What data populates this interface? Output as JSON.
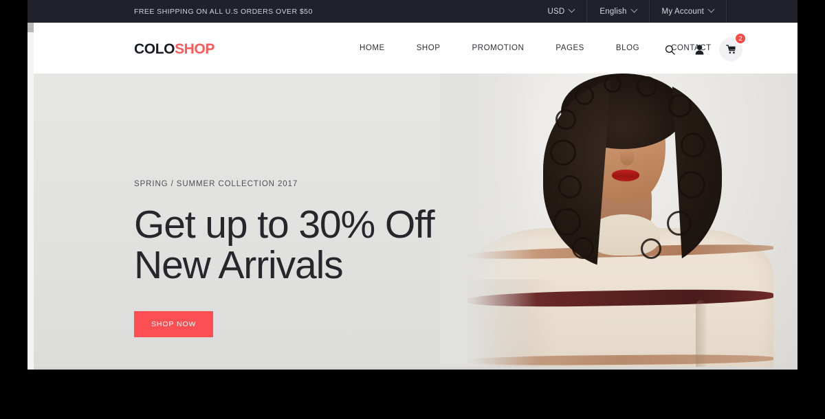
{
  "topbar": {
    "announcement": "FREE SHIPPING ON ALL U.S ORDERS OVER $50",
    "dropdowns": [
      {
        "label": "USD",
        "icon": "chevron-down-icon"
      },
      {
        "label": "English",
        "icon": "chevron-down-icon"
      },
      {
        "label": "My Account",
        "icon": "chevron-down-icon"
      }
    ],
    "bg_color": "#21212c",
    "text_color": "#d3d2da"
  },
  "header": {
    "logo": {
      "part1": "COLO",
      "part2": "SHOP",
      "part1_color": "#1b1b24",
      "part2_color": "#fb5b5b"
    },
    "nav": [
      {
        "label": "HOME"
      },
      {
        "label": "SHOP"
      },
      {
        "label": "PROMOTION"
      },
      {
        "label": "PAGES"
      },
      {
        "label": "BLOG"
      },
      {
        "label": "CONTACT"
      }
    ],
    "icons": [
      {
        "name": "search-icon"
      },
      {
        "name": "user-icon"
      },
      {
        "name": "cart-icon"
      }
    ],
    "cart_count": "2",
    "cart_badge_color": "#fb4a4a"
  },
  "hero": {
    "eyebrow": "SPRING / SUMMER COLLECTION 2017",
    "heading": "Get up to 30% Off\nNew Arrivals",
    "cta_label": "SHOP NOW",
    "cta_color": "#fb4f53",
    "bg_color": "#e2e2e0",
    "image_alt": "fashion-model-photo"
  }
}
